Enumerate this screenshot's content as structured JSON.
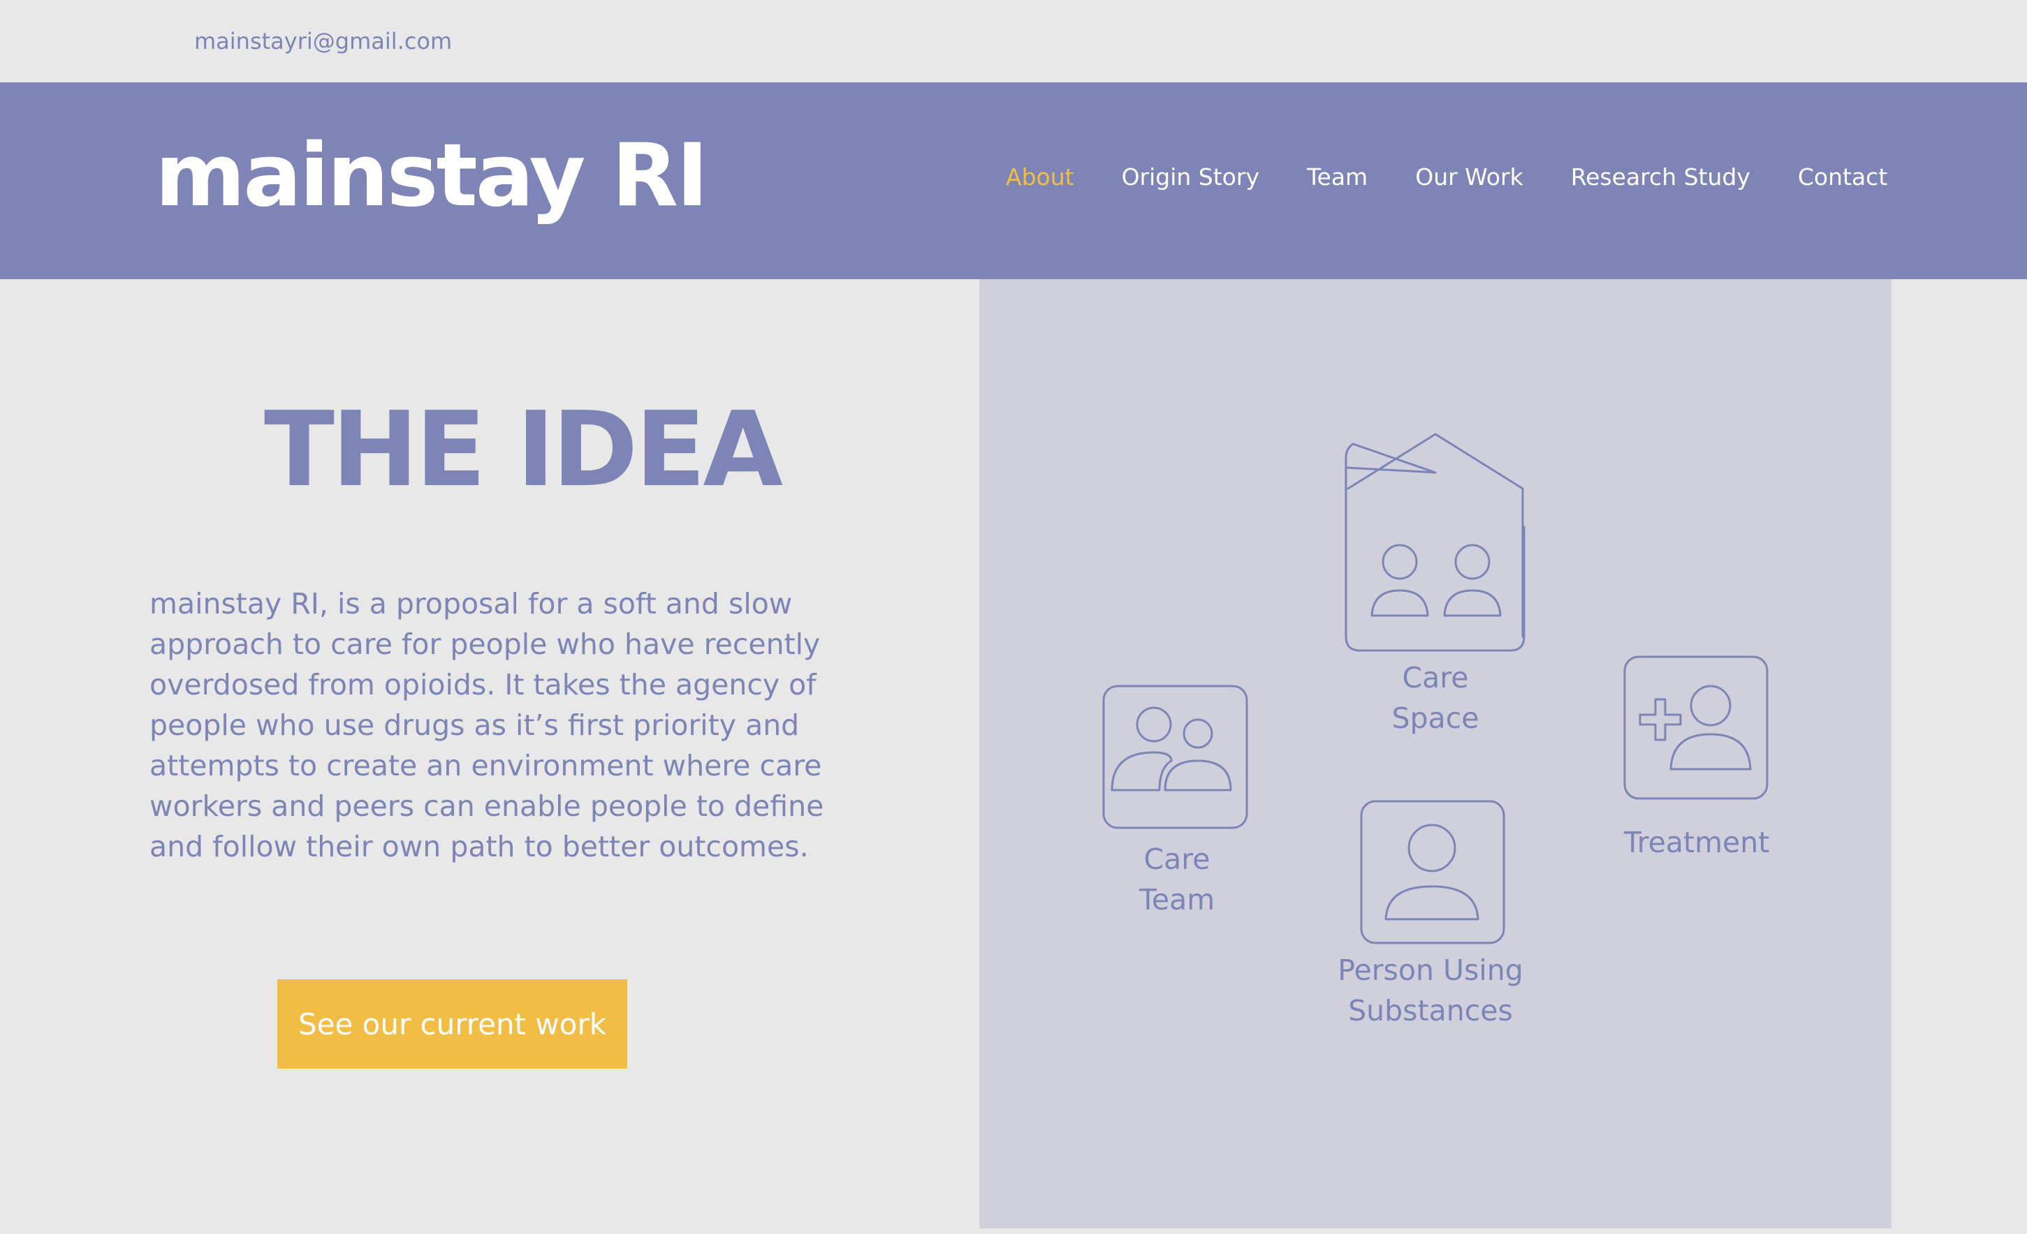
{
  "topbar": {
    "email": "mainstayri@gmail.com"
  },
  "header": {
    "logo": "mainstay RI",
    "nav": [
      {
        "label": "About",
        "active": true
      },
      {
        "label": "Origin Story"
      },
      {
        "label": "Team"
      },
      {
        "label": "Our Work"
      },
      {
        "label": "Research Study"
      },
      {
        "label": "Contact"
      }
    ]
  },
  "idea": {
    "title": "THE IDEA",
    "body": "mainstay RI, is a proposal for a soft and slow approach to care for people who have recently overdosed from opioids. It takes the agency of people who use drugs as it’s first priority and attempts to create an environment where care workers and peers can enable people to define and follow their own path to better outcomes.",
    "cta": "See our current work"
  },
  "diagram": {
    "care_space": {
      "line1": "Care",
      "line2": "Space",
      "icon": "house-people-icon"
    },
    "care_team": {
      "line1": "Care",
      "line2": "Team",
      "icon": "two-people-icon"
    },
    "person": {
      "line1": "Person Using",
      "line2": "Substances",
      "icon": "person-icon"
    },
    "treatment": {
      "line1": "Treatment",
      "icon": "medical-person-icon"
    }
  },
  "colors": {
    "accent": "#f2bd45",
    "brand": "#7e84b5",
    "panel": "#d0d0dd",
    "background": "#e8e8e8"
  }
}
